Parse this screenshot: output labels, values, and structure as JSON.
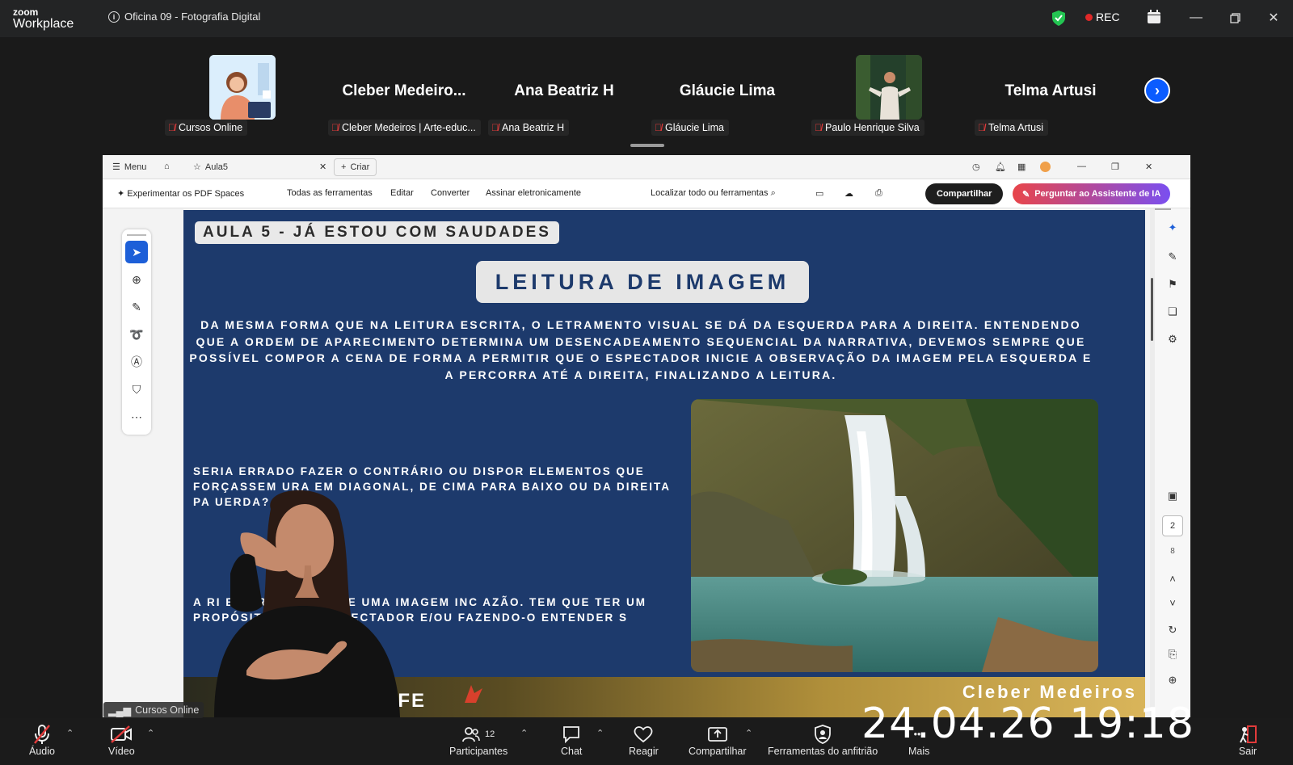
{
  "titlebar": {
    "logo_top": "zoom",
    "logo_bottom": "Workplace",
    "meeting_title": "Oficina 09 - Fotografia Digital",
    "rec_label": "REC"
  },
  "gallery": {
    "tiles": [
      {
        "label": "Cursos Online",
        "big_name": ""
      },
      {
        "label": "Cleber Medeiros | Arte-educ...",
        "big_name": "Cleber  Medeiro..."
      },
      {
        "label": "Ana Beatriz H",
        "big_name": "Ana Beatriz H"
      },
      {
        "label": "Gláucie Lima",
        "big_name": "Gláucie Lima"
      },
      {
        "label": "Paulo Henrique Silva",
        "big_name": ""
      },
      {
        "label": "Telma Artusi",
        "big_name": "Telma Artusi"
      }
    ]
  },
  "pdf": {
    "menu": "Menu",
    "tab_name": "Aula5",
    "new_tab": "Criar",
    "try_spaces": "Experimentar os PDF Spaces",
    "tools": [
      "Todas as ferramentas",
      "Editar",
      "Converter",
      "Assinar eletronicamente"
    ],
    "search_placeholder": "Localizar todo ou ferramentas",
    "share_button": "Compartilhar",
    "ai_button": "Perguntar ao Assistente de IA",
    "page_number": "2",
    "page_total": "8"
  },
  "slide": {
    "tag": "AULA 5 - JÁ ESTOU COM SAUDADES",
    "title": "LEITURA DE IMAGEM",
    "paragraph": "DA MESMA FORMA QUE NA LEITURA ESCRITA, O LETRAMENTO VISUAL SE DÁ DA ESQUERDA PARA A DIREITA. ENTENDENDO QUE A ORDEM DE APARECIMENTO DETERMINA UM DESENCADEAMENTO SEQUENCIAL DA NARRATIVA, DEVEMOS SEMPRE QUE POSSÍVEL COMPOR A CENA DE FORMA A PERMITIR QUE O ESPECTADOR INICIE A OBSERVAÇÃO DA IMAGEM PELA ESQUERDA E A PERCORRA ATÉ A DIREITA, FINALIZANDO A LEITURA.",
    "question": "SERIA ERRADO FAZER O CONTRÁRIO OU DISPOR ELEMENTOS QUE FORÇASSEM      URA EM DIAGONAL, DE CIMA PARA BAIXO OU DA DIREITA PA        UERDA?",
    "answer": "A RI                   E ERRADO, MAS SE UMA IMAGEM INC                  AZÃO. TEM QUE TER UM PROPÓSITO QUE AC                 SPECTADOR E/OU FAZENDO-O ENTENDER S",
    "footer_author": "Cleber Medeiros"
  },
  "share_label": "Cursos Online",
  "timestamp": "24.04.26 19:18",
  "toolbar": {
    "audio": "Áudio",
    "video": "Vídeo",
    "participants": "Participantes",
    "participants_count": "12",
    "chat": "Chat",
    "react": "Reagir",
    "share": "Compartilhar",
    "host_tools": "Ferramentas do anfitrião",
    "more": "Mais",
    "leave": "Sair"
  },
  "colors": {
    "zoom_blue": "#0b5cff",
    "slide_blue": "#1d3a6c",
    "rec_red": "#e02828",
    "muted_red": "#e23b3b"
  }
}
